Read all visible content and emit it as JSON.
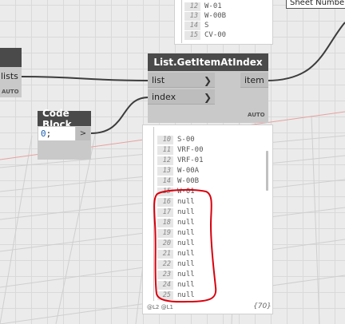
{
  "top_preview": {
    "rows": [
      {
        "index": "12",
        "value": "W-01"
      },
      {
        "index": "13",
        "value": "W-00B"
      },
      {
        "index": "14",
        "value": "S"
      },
      {
        "index": "15",
        "value": "CV-00"
      }
    ]
  },
  "sheet_number": {
    "label": "Sheet Number"
  },
  "left_node": {
    "port_label": "lists",
    "lacing": "AUTO"
  },
  "getitem_node": {
    "title": "List.GetItemAtIndex",
    "inputs": [
      {
        "label": "list"
      },
      {
        "label": "index"
      }
    ],
    "output": "item",
    "lacing": "AUTO"
  },
  "code_block": {
    "title": "Code Block",
    "code_num": "0",
    "code_semicolon": ";",
    "output_port": ">"
  },
  "preview": {
    "rows": [
      {
        "index": "10",
        "value": "S-00"
      },
      {
        "index": "11",
        "value": "VRF-00"
      },
      {
        "index": "12",
        "value": "VRF-01"
      },
      {
        "index": "13",
        "value": "W-00A"
      },
      {
        "index": "14",
        "value": "W-00B"
      },
      {
        "index": "15",
        "value": "W-01"
      },
      {
        "index": "16",
        "value": "null"
      },
      {
        "index": "17",
        "value": "null"
      },
      {
        "index": "18",
        "value": "null"
      },
      {
        "index": "19",
        "value": "null"
      },
      {
        "index": "20",
        "value": "null"
      },
      {
        "index": "21",
        "value": "null"
      },
      {
        "index": "22",
        "value": "null"
      },
      {
        "index": "23",
        "value": "null"
      },
      {
        "index": "24",
        "value": "null"
      },
      {
        "index": "25",
        "value": "null"
      }
    ],
    "levels": "@L2 @L1",
    "count": "{70}"
  },
  "colors": {
    "node_header": "#4a4a4a",
    "node_body": "#c9c9c9",
    "wire": "#3c3c3c",
    "highlight": "#d9000d",
    "code_number": "#1a5fb4"
  }
}
